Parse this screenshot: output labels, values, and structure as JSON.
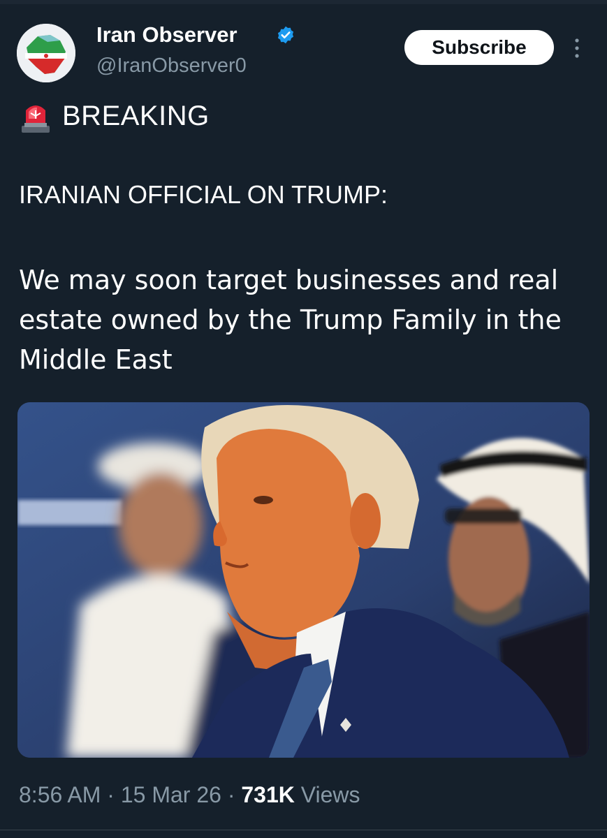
{
  "tweet": {
    "author_name": "Iran Observer",
    "author_handle": "@IranObserver0",
    "verified_icon": "verified-badge-icon",
    "subscribe_label": "Subscribe",
    "more_icon": "more-vertical-icon",
    "siren_icon": "police-light-emoji",
    "breaking_label": "BREAKING",
    "headline": "IRANIAN OFFICIAL ON TRUMP:",
    "body": "We may soon target businesses and real estate owned by the Trump Family in the Middle East",
    "time": "8:56 AM",
    "date": "15 Mar 26",
    "views_count": "731K",
    "views_label": "Views",
    "separator": "·"
  },
  "colors": {
    "background": "#15202b",
    "text_primary": "#ffffff",
    "text_secondary": "#8899a6",
    "verified_blue": "#1d9bf0"
  }
}
